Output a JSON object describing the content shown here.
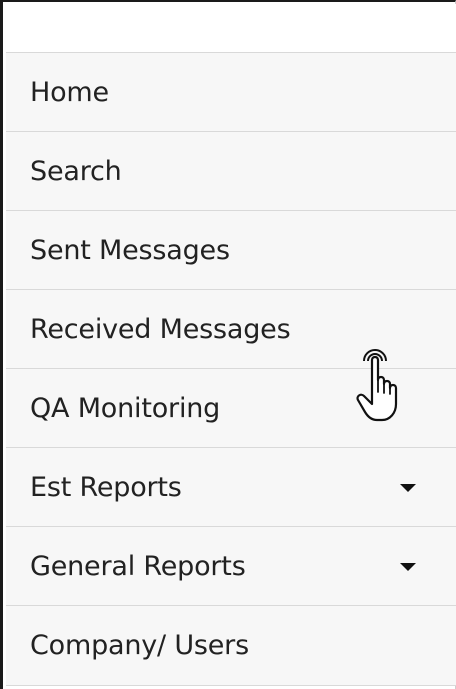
{
  "nav": {
    "items": [
      {
        "label": "Home"
      },
      {
        "label": "Search"
      },
      {
        "label": "Sent Messages"
      },
      {
        "label": "Received Messages"
      },
      {
        "label": "QA Monitoring"
      },
      {
        "label": "Est Reports",
        "icon": "caret-down-icon"
      },
      {
        "label": "General Reports",
        "icon": "caret-down-icon"
      },
      {
        "label": "Company/ Users"
      }
    ]
  },
  "cursor": {
    "icon": "hand-pointer-icon",
    "hovering": "Received Messages"
  },
  "colors": {
    "text": "#222222",
    "item_background": "#f7f7f7",
    "divider": "#d9d9d9",
    "border": "#1a1a1a"
  }
}
